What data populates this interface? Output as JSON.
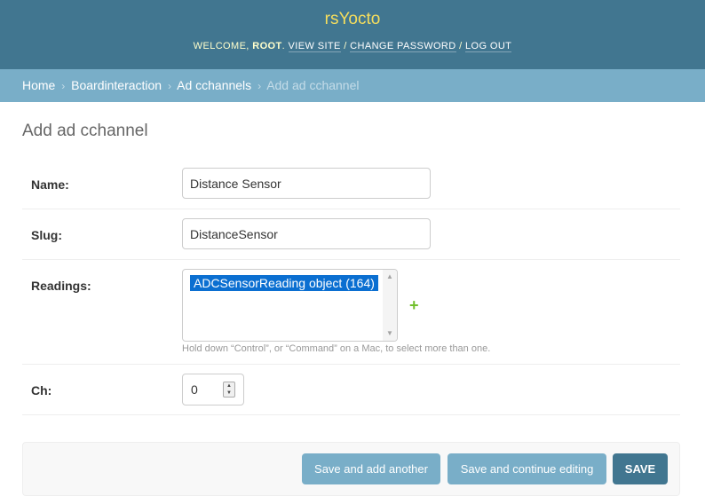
{
  "header": {
    "site_name": "rsYocto",
    "welcome_prefix": "WELCOME, ",
    "username": "ROOT",
    "welcome_suffix": ". ",
    "view_site": "VIEW SITE",
    "separator": " / ",
    "change_password": "CHANGE PASSWORD",
    "log_out": "LOG OUT"
  },
  "breadcrumbs": {
    "home": "Home",
    "app": "Boardinteraction",
    "model": "Ad cchannels",
    "current": "Add ad cchannel",
    "arrow": "›"
  },
  "page_title": "Add ad cchannel",
  "form": {
    "name": {
      "label": "Name:",
      "value": "Distance Sensor"
    },
    "slug": {
      "label": "Slug:",
      "value": "DistanceSensor"
    },
    "readings": {
      "label": "Readings:",
      "selected_option": "ADCSensorReading object (164)",
      "add_icon": "+",
      "help_text": "Hold down “Control”, or “Command” on a Mac, to select more than one."
    },
    "ch": {
      "label": "Ch:",
      "value": "0"
    }
  },
  "buttons": {
    "save_add_another": "Save and add another",
    "save_continue": "Save and continue editing",
    "save": "SAVE"
  },
  "colors": {
    "header_bg": "#417690",
    "breadcrumb_bg": "#79aec8",
    "branding": "#f5dd5d",
    "add_icon": "#70bf2b",
    "selected_option": "#0b6fd1"
  }
}
